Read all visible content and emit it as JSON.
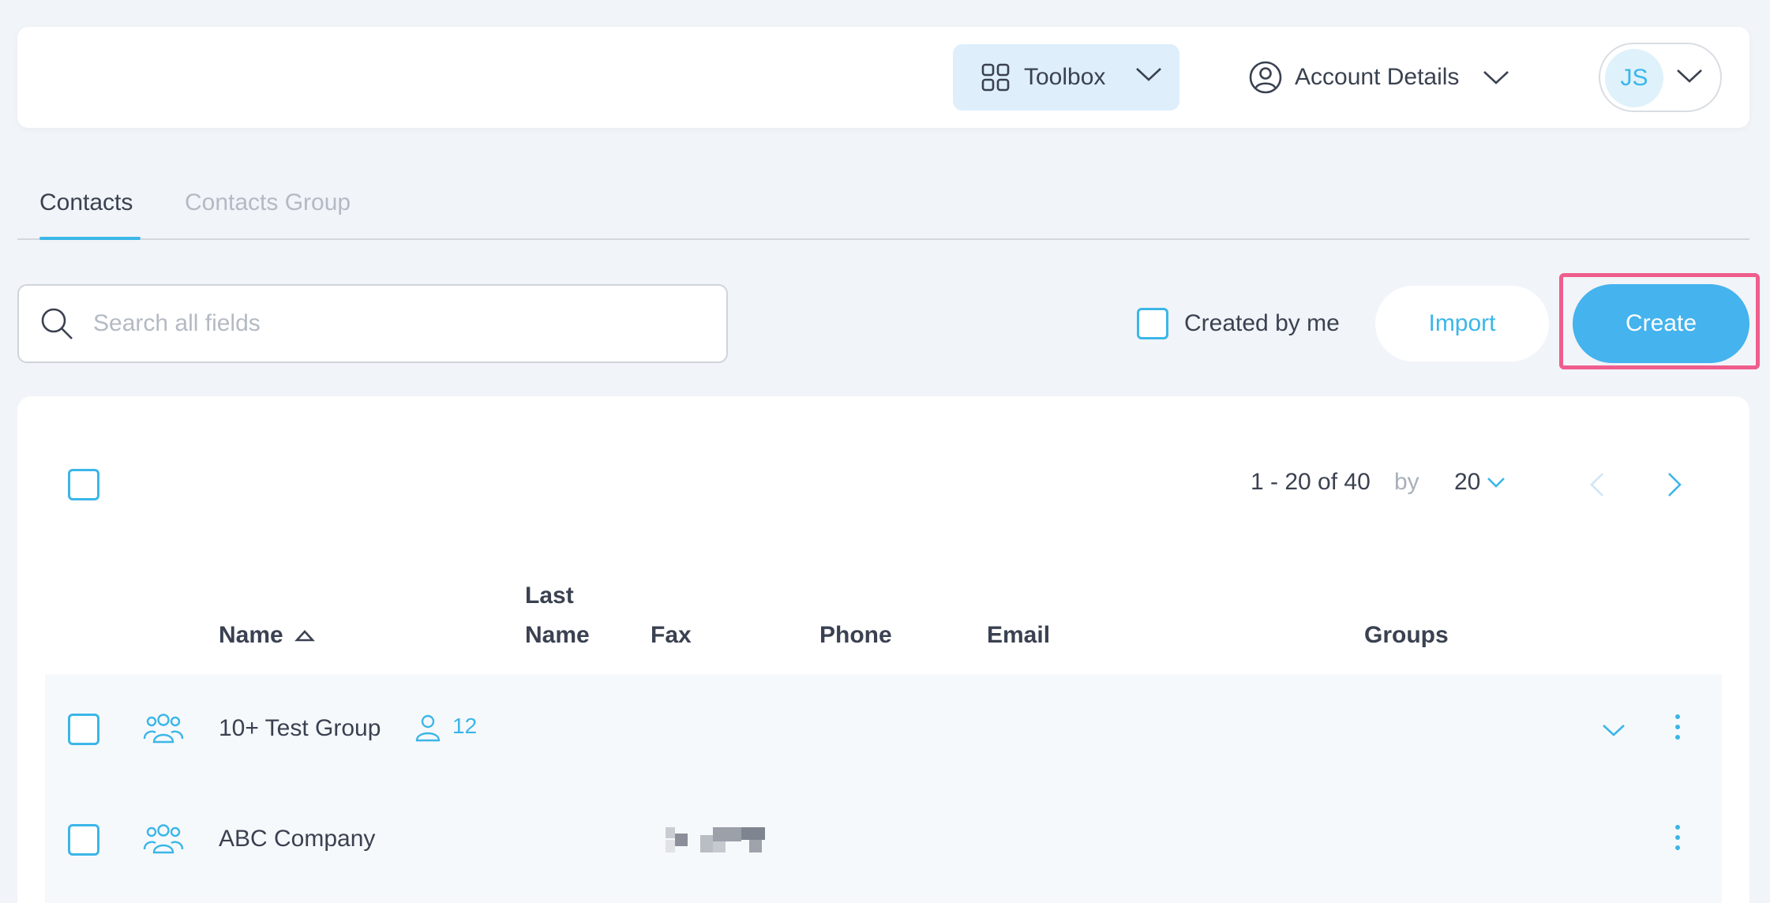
{
  "header": {
    "toolbox_label": "Toolbox",
    "account_label": "Account Details",
    "avatar_initials": "JS"
  },
  "tabs": [
    {
      "label": "Contacts",
      "active": true
    },
    {
      "label": "Contacts Group",
      "active": false
    }
  ],
  "toolbar": {
    "search_placeholder": "Search all fields",
    "search_value": "",
    "created_by_me_label": "Created by me",
    "created_by_me_checked": false,
    "import_label": "Import",
    "create_label": "Create"
  },
  "pagination": {
    "range": "1 - 20 of 40",
    "by_label": "by",
    "page_size": "20"
  },
  "table": {
    "columns": {
      "name": "Name",
      "last_name_line1": "Last",
      "last_name_line2": "Name",
      "fax": "Fax",
      "phone": "Phone",
      "email": "Email",
      "groups": "Groups"
    },
    "rows": [
      {
        "name": "10+ Test Group",
        "member_count": "12",
        "type_icon": "group-icon",
        "expandable": true
      },
      {
        "name": "ABC Company",
        "type_icon": "group-icon",
        "fax_redacted": true,
        "expandable": false
      }
    ]
  },
  "colors": {
    "accent": "#3bb6e8",
    "create_button": "#44b3ee",
    "highlight": "#ef5d8c",
    "background": "#f1f4f8",
    "toolbox_bg": "#deeefb"
  }
}
